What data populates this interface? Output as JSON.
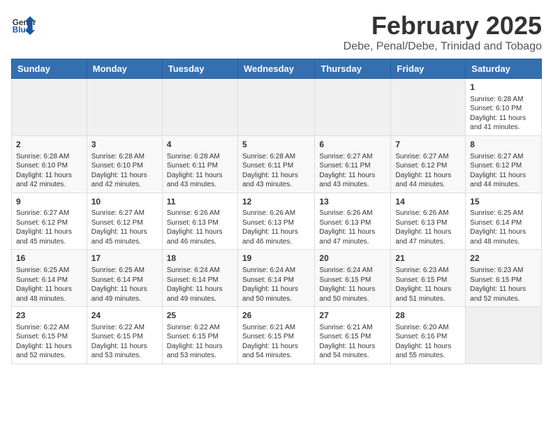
{
  "header": {
    "logo_general": "General",
    "logo_blue": "Blue",
    "month_title": "February 2025",
    "subtitle": "Debe, Penal/Debe, Trinidad and Tobago"
  },
  "weekdays": [
    "Sunday",
    "Monday",
    "Tuesday",
    "Wednesday",
    "Thursday",
    "Friday",
    "Saturday"
  ],
  "weeks": [
    [
      {
        "day": "",
        "info": ""
      },
      {
        "day": "",
        "info": ""
      },
      {
        "day": "",
        "info": ""
      },
      {
        "day": "",
        "info": ""
      },
      {
        "day": "",
        "info": ""
      },
      {
        "day": "",
        "info": ""
      },
      {
        "day": "1",
        "info": "Sunrise: 6:28 AM\nSunset: 6:10 PM\nDaylight: 11 hours and 41 minutes."
      }
    ],
    [
      {
        "day": "2",
        "info": "Sunrise: 6:28 AM\nSunset: 6:10 PM\nDaylight: 11 hours and 42 minutes."
      },
      {
        "day": "3",
        "info": "Sunrise: 6:28 AM\nSunset: 6:10 PM\nDaylight: 11 hours and 42 minutes."
      },
      {
        "day": "4",
        "info": "Sunrise: 6:28 AM\nSunset: 6:11 PM\nDaylight: 11 hours and 43 minutes."
      },
      {
        "day": "5",
        "info": "Sunrise: 6:28 AM\nSunset: 6:11 PM\nDaylight: 11 hours and 43 minutes."
      },
      {
        "day": "6",
        "info": "Sunrise: 6:27 AM\nSunset: 6:11 PM\nDaylight: 11 hours and 43 minutes."
      },
      {
        "day": "7",
        "info": "Sunrise: 6:27 AM\nSunset: 6:12 PM\nDaylight: 11 hours and 44 minutes."
      },
      {
        "day": "8",
        "info": "Sunrise: 6:27 AM\nSunset: 6:12 PM\nDaylight: 11 hours and 44 minutes."
      }
    ],
    [
      {
        "day": "9",
        "info": "Sunrise: 6:27 AM\nSunset: 6:12 PM\nDaylight: 11 hours and 45 minutes."
      },
      {
        "day": "10",
        "info": "Sunrise: 6:27 AM\nSunset: 6:12 PM\nDaylight: 11 hours and 45 minutes."
      },
      {
        "day": "11",
        "info": "Sunrise: 6:26 AM\nSunset: 6:13 PM\nDaylight: 11 hours and 46 minutes."
      },
      {
        "day": "12",
        "info": "Sunrise: 6:26 AM\nSunset: 6:13 PM\nDaylight: 11 hours and 46 minutes."
      },
      {
        "day": "13",
        "info": "Sunrise: 6:26 AM\nSunset: 6:13 PM\nDaylight: 11 hours and 47 minutes."
      },
      {
        "day": "14",
        "info": "Sunrise: 6:26 AM\nSunset: 6:13 PM\nDaylight: 11 hours and 47 minutes."
      },
      {
        "day": "15",
        "info": "Sunrise: 6:25 AM\nSunset: 6:14 PM\nDaylight: 11 hours and 48 minutes."
      }
    ],
    [
      {
        "day": "16",
        "info": "Sunrise: 6:25 AM\nSunset: 6:14 PM\nDaylight: 11 hours and 48 minutes."
      },
      {
        "day": "17",
        "info": "Sunrise: 6:25 AM\nSunset: 6:14 PM\nDaylight: 11 hours and 49 minutes."
      },
      {
        "day": "18",
        "info": "Sunrise: 6:24 AM\nSunset: 6:14 PM\nDaylight: 11 hours and 49 minutes."
      },
      {
        "day": "19",
        "info": "Sunrise: 6:24 AM\nSunset: 6:14 PM\nDaylight: 11 hours and 50 minutes."
      },
      {
        "day": "20",
        "info": "Sunrise: 6:24 AM\nSunset: 6:15 PM\nDaylight: 11 hours and 50 minutes."
      },
      {
        "day": "21",
        "info": "Sunrise: 6:23 AM\nSunset: 6:15 PM\nDaylight: 11 hours and 51 minutes."
      },
      {
        "day": "22",
        "info": "Sunrise: 6:23 AM\nSunset: 6:15 PM\nDaylight: 11 hours and 52 minutes."
      }
    ],
    [
      {
        "day": "23",
        "info": "Sunrise: 6:22 AM\nSunset: 6:15 PM\nDaylight: 11 hours and 52 minutes."
      },
      {
        "day": "24",
        "info": "Sunrise: 6:22 AM\nSunset: 6:15 PM\nDaylight: 11 hours and 53 minutes."
      },
      {
        "day": "25",
        "info": "Sunrise: 6:22 AM\nSunset: 6:15 PM\nDaylight: 11 hours and 53 minutes."
      },
      {
        "day": "26",
        "info": "Sunrise: 6:21 AM\nSunset: 6:15 PM\nDaylight: 11 hours and 54 minutes."
      },
      {
        "day": "27",
        "info": "Sunrise: 6:21 AM\nSunset: 6:15 PM\nDaylight: 11 hours and 54 minutes."
      },
      {
        "day": "28",
        "info": "Sunrise: 6:20 AM\nSunset: 6:16 PM\nDaylight: 11 hours and 55 minutes."
      },
      {
        "day": "",
        "info": ""
      }
    ]
  ]
}
